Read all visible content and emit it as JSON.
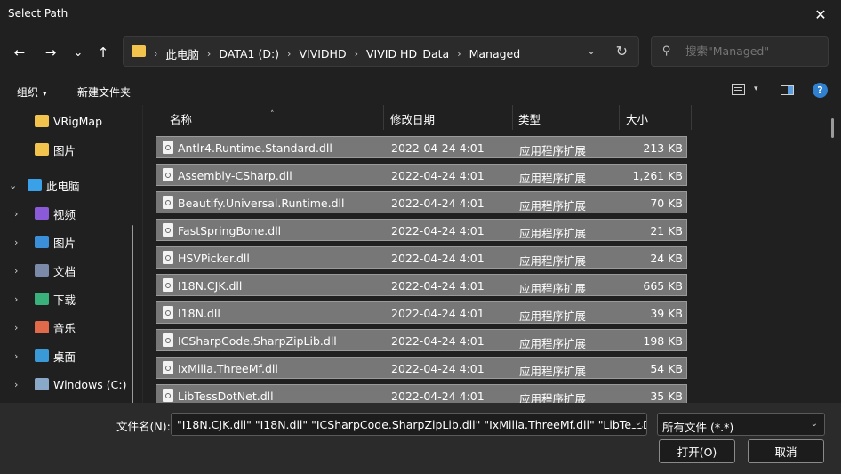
{
  "window": {
    "title": "Select Path",
    "close_glyph": "✕"
  },
  "nav": {
    "back_glyph": "←",
    "forward_glyph": "→",
    "recent_glyph": "⌄",
    "up_glyph": "↑",
    "breadcrumbs": [
      "此电脑",
      "DATA1 (D:)",
      "VIVIDHD",
      "VIVID HD_Data",
      "Managed"
    ],
    "crumb_sep": "›",
    "dropdown_glyph": "⌄",
    "refresh_glyph": "↻",
    "search_placeholder": "搜索\"Managed\"",
    "search_glyph": "⚲"
  },
  "toolbar": {
    "organize_label": "组织",
    "new_folder_label": "新建文件夹",
    "caret": "▾",
    "help_glyph": "?"
  },
  "sidebar": {
    "items": [
      {
        "label": "VRigMap",
        "icon": "folder-icon",
        "color": "#f2c44d"
      },
      {
        "label": "图片",
        "icon": "folder-icon",
        "color": "#f2c44d"
      },
      {
        "label": "此电脑",
        "icon": "monitor-icon",
        "color": "#3aa0e8",
        "chevron": "⌄"
      },
      {
        "label": "视频",
        "icon": "video-icon",
        "color": "#8a5ad8",
        "chevron": "›"
      },
      {
        "label": "图片",
        "icon": "pictures-icon",
        "color": "#3a8fd8",
        "chevron": "›"
      },
      {
        "label": "文档",
        "icon": "documents-icon",
        "color": "#7a8aa8",
        "chevron": "›"
      },
      {
        "label": "下载",
        "icon": "download-icon",
        "color": "#3ab07a",
        "chevron": "›"
      },
      {
        "label": "音乐",
        "icon": "music-icon",
        "color": "#e06a4a",
        "chevron": "›"
      },
      {
        "label": "桌面",
        "icon": "desktop-icon",
        "color": "#3a9ad8",
        "chevron": "›"
      },
      {
        "label": "Windows (C:)",
        "icon": "drive-icon",
        "color": "#8aa8c8",
        "chevron": "›"
      }
    ]
  },
  "columns": {
    "name": "名称",
    "modified": "修改日期",
    "type": "类型",
    "size": "大小",
    "sort_glyph": "˄"
  },
  "files": [
    {
      "name": "Antlr4.Runtime.Standard.dll",
      "modified": "2022-04-24 4:01",
      "type": "应用程序扩展",
      "size": "213 KB"
    },
    {
      "name": "Assembly-CSharp.dll",
      "modified": "2022-04-24 4:01",
      "type": "应用程序扩展",
      "size": "1,261 KB"
    },
    {
      "name": "Beautify.Universal.Runtime.dll",
      "modified": "2022-04-24 4:01",
      "type": "应用程序扩展",
      "size": "70 KB"
    },
    {
      "name": "FastSpringBone.dll",
      "modified": "2022-04-24 4:01",
      "type": "应用程序扩展",
      "size": "21 KB"
    },
    {
      "name": "HSVPicker.dll",
      "modified": "2022-04-24 4:01",
      "type": "应用程序扩展",
      "size": "24 KB"
    },
    {
      "name": "I18N.CJK.dll",
      "modified": "2022-04-24 4:01",
      "type": "应用程序扩展",
      "size": "665 KB"
    },
    {
      "name": "I18N.dll",
      "modified": "2022-04-24 4:01",
      "type": "应用程序扩展",
      "size": "39 KB"
    },
    {
      "name": "ICSharpCode.SharpZipLib.dll",
      "modified": "2022-04-24 4:01",
      "type": "应用程序扩展",
      "size": "198 KB"
    },
    {
      "name": "IxMilia.ThreeMf.dll",
      "modified": "2022-04-24 4:01",
      "type": "应用程序扩展",
      "size": "54 KB"
    },
    {
      "name": "LibTessDotNet.dll",
      "modified": "2022-04-24 4:01",
      "type": "应用程序扩展",
      "size": "35 KB"
    }
  ],
  "footer": {
    "filename_label": "文件名(N):",
    "filename_value": "\"I18N.CJK.dll\" \"I18N.dll\" \"ICSharpCode.SharpZipLib.dll\" \"IxMilia.ThreeMf.dll\" \"LibTessDotNet.dll\"",
    "filetype_value": "所有文件 (*.*)",
    "dropdown_glyph": "⌄",
    "open_label": "打开(O)",
    "cancel_label": "取消"
  }
}
